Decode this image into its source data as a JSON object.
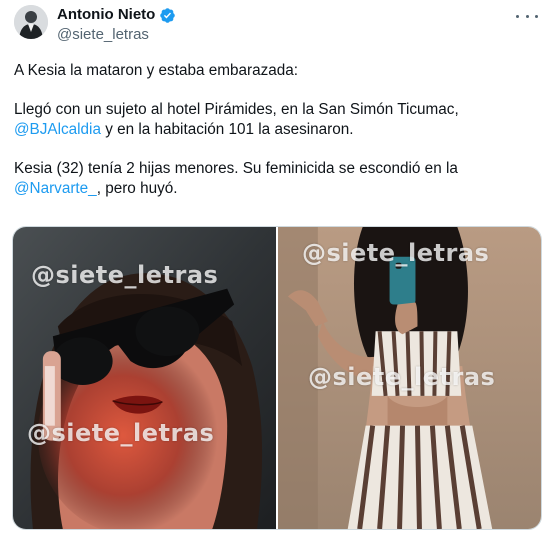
{
  "author": {
    "display_name": "Antonio Nieto",
    "handle": "@siete_letras",
    "verified": true,
    "verified_color": "#1d9bf0",
    "avatar_icon": "profile-photo"
  },
  "menu_icon": "more-options-icon",
  "tweet": {
    "line1": "A Kesia la mataron y estaba embarazada:",
    "para2_part1": "Llegó con un sujeto al hotel Pirámides, en la San Simón Ticumac,",
    "para2_mention": "@BJAlcaldia",
    "para2_part2": " y en la habitación 101 la asesinaron.",
    "para3_part1": "Kesia (32) tenía 2 hijas menores. Su feminicida se escondió en la",
    "para3_mention": "@Narvarte_",
    "para3_part2": ", pero huyó."
  },
  "media": {
    "photo1": {
      "watermark_top": "@siete_letras",
      "watermark_bottom": "@siete_letras"
    },
    "photo2": {
      "watermark_top": "@siete_letras",
      "watermark_middle": "@siete_letras"
    }
  },
  "colors": {
    "mention": "#1d9bf0",
    "text": "#0f1419",
    "secondary": "#536471"
  }
}
